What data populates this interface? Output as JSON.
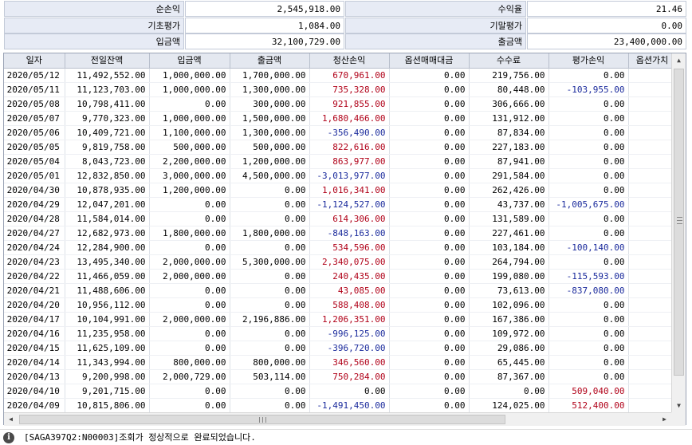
{
  "summary": [
    {
      "label": "순손익",
      "value": "2,545,918.00",
      "label2": "수익율",
      "value2": "21.46"
    },
    {
      "label": "기초평가",
      "value": "1,084.00",
      "label2": "기말평가",
      "value2": "0.00"
    },
    {
      "label": "입금액",
      "value": "32,100,729.00",
      "label2": "출금액",
      "value2": "23,400,000.00"
    }
  ],
  "table": {
    "columns": [
      "일자",
      "전일잔액",
      "입금액",
      "출금액",
      "청산손익",
      "옵션매매대금",
      "수수료",
      "평가손익",
      "옵션가치"
    ],
    "rows": [
      [
        "2020/05/12",
        "11,492,552.00",
        "1,000,000.00",
        "1,700,000.00",
        "670,961.00",
        "0.00",
        "219,756.00",
        "0.00",
        ""
      ],
      [
        "2020/05/11",
        "11,123,703.00",
        "1,000,000.00",
        "1,300,000.00",
        "735,328.00",
        "0.00",
        "80,448.00",
        "-103,955.00",
        ""
      ],
      [
        "2020/05/08",
        "10,798,411.00",
        "0.00",
        "300,000.00",
        "921,855.00",
        "0.00",
        "306,666.00",
        "0.00",
        ""
      ],
      [
        "2020/05/07",
        "9,770,323.00",
        "1,000,000.00",
        "1,500,000.00",
        "1,680,466.00",
        "0.00",
        "131,912.00",
        "0.00",
        ""
      ],
      [
        "2020/05/06",
        "10,409,721.00",
        "1,100,000.00",
        "1,300,000.00",
        "-356,490.00",
        "0.00",
        "87,834.00",
        "0.00",
        ""
      ],
      [
        "2020/05/05",
        "9,819,758.00",
        "500,000.00",
        "500,000.00",
        "822,616.00",
        "0.00",
        "227,183.00",
        "0.00",
        ""
      ],
      [
        "2020/05/04",
        "8,043,723.00",
        "2,200,000.00",
        "1,200,000.00",
        "863,977.00",
        "0.00",
        "87,941.00",
        "0.00",
        ""
      ],
      [
        "2020/05/01",
        "12,832,850.00",
        "3,000,000.00",
        "4,500,000.00",
        "-3,013,977.00",
        "0.00",
        "291,584.00",
        "0.00",
        ""
      ],
      [
        "2020/04/30",
        "10,878,935.00",
        "1,200,000.00",
        "0.00",
        "1,016,341.00",
        "0.00",
        "262,426.00",
        "0.00",
        ""
      ],
      [
        "2020/04/29",
        "12,047,201.00",
        "0.00",
        "0.00",
        "-1,124,527.00",
        "0.00",
        "43,737.00",
        "-1,005,675.00",
        ""
      ],
      [
        "2020/04/28",
        "11,584,014.00",
        "0.00",
        "0.00",
        "614,306.00",
        "0.00",
        "131,589.00",
        "0.00",
        ""
      ],
      [
        "2020/04/27",
        "12,682,973.00",
        "1,800,000.00",
        "1,800,000.00",
        "-848,163.00",
        "0.00",
        "227,461.00",
        "0.00",
        ""
      ],
      [
        "2020/04/24",
        "12,284,900.00",
        "0.00",
        "0.00",
        "534,596.00",
        "0.00",
        "103,184.00",
        "-100,140.00",
        ""
      ],
      [
        "2020/04/23",
        "13,495,340.00",
        "2,000,000.00",
        "5,300,000.00",
        "2,340,075.00",
        "0.00",
        "264,794.00",
        "0.00",
        ""
      ],
      [
        "2020/04/22",
        "11,466,059.00",
        "2,000,000.00",
        "0.00",
        "240,435.00",
        "0.00",
        "199,080.00",
        "-115,593.00",
        ""
      ],
      [
        "2020/04/21",
        "11,488,606.00",
        "0.00",
        "0.00",
        "43,085.00",
        "0.00",
        "73,613.00",
        "-837,080.00",
        ""
      ],
      [
        "2020/04/20",
        "10,956,112.00",
        "0.00",
        "0.00",
        "588,408.00",
        "0.00",
        "102,096.00",
        "0.00",
        ""
      ],
      [
        "2020/04/17",
        "10,104,991.00",
        "2,000,000.00",
        "2,196,886.00",
        "1,206,351.00",
        "0.00",
        "167,386.00",
        "0.00",
        ""
      ],
      [
        "2020/04/16",
        "11,235,958.00",
        "0.00",
        "0.00",
        "-996,125.00",
        "0.00",
        "109,972.00",
        "0.00",
        ""
      ],
      [
        "2020/04/15",
        "11,625,109.00",
        "0.00",
        "0.00",
        "-396,720.00",
        "0.00",
        "29,086.00",
        "0.00",
        ""
      ],
      [
        "2020/04/14",
        "11,343,994.00",
        "800,000.00",
        "800,000.00",
        "346,560.00",
        "0.00",
        "65,445.00",
        "0.00",
        ""
      ],
      [
        "2020/04/13",
        "9,200,998.00",
        "2,000,729.00",
        "503,114.00",
        "750,284.00",
        "0.00",
        "87,367.00",
        "0.00",
        ""
      ],
      [
        "2020/04/10",
        "9,201,715.00",
        "0.00",
        "0.00",
        "0.00",
        "0.00",
        "0.00",
        "509,040.00",
        ""
      ],
      [
        "2020/04/09",
        "10,815,806.00",
        "0.00",
        "0.00",
        "-1,491,450.00",
        "0.00",
        "124,025.00",
        "512,400.00",
        ""
      ]
    ]
  },
  "scrollbar": {
    "up_icon": "▲",
    "down_icon": "▼",
    "left_icon": "◀",
    "right_icon": "▶"
  },
  "status": {
    "icon": "i",
    "message": "[SAGA397Q2:N00003]조회가 정상적으로 완료되었습니다."
  },
  "colors": {
    "positive": "#b00018",
    "negative": "#1a2a9c",
    "header_bg": "#e4e8f0",
    "label_bg": "#e7ebf5"
  }
}
